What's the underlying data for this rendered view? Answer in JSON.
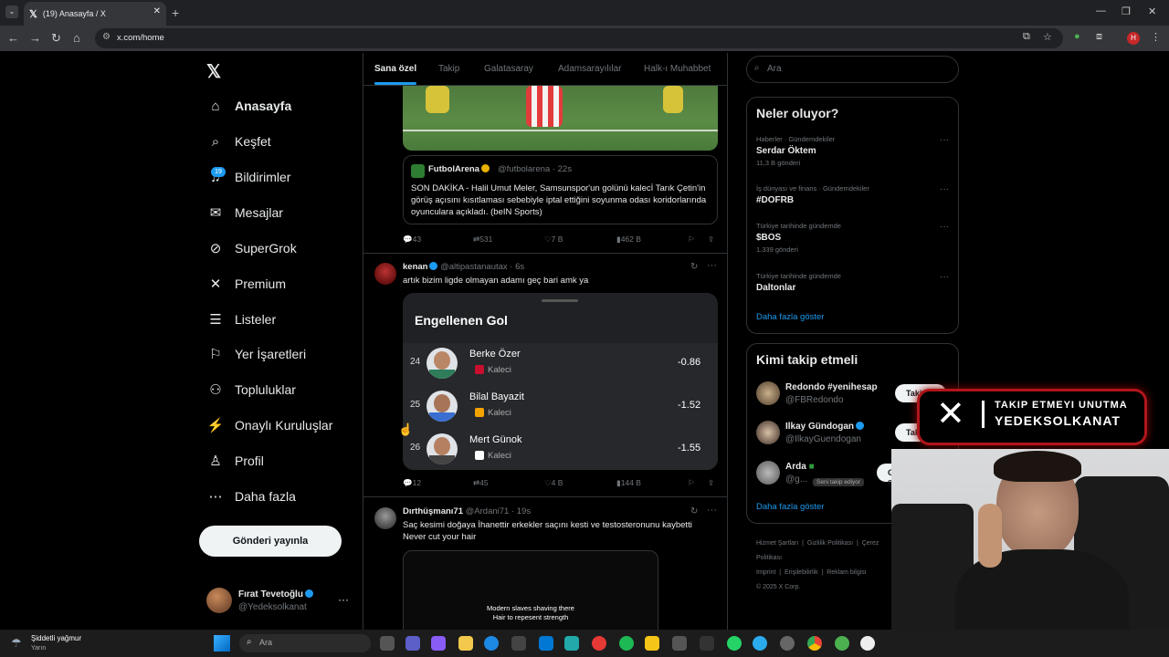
{
  "browser": {
    "tab_title": "(19) Anasayfa / X",
    "tab_close": "✕",
    "new_tab": "+",
    "url": "x.com/home",
    "profile_initial": "H"
  },
  "sidebar": {
    "logo": "𝕏",
    "items": [
      {
        "icon": "home-icon",
        "glyph": "⌂",
        "label": "Anasayfa"
      },
      {
        "icon": "search-icon",
        "glyph": "⌕",
        "label": "Keşfet"
      },
      {
        "icon": "bell-icon",
        "glyph": "♫",
        "label": "Bildirimler"
      },
      {
        "icon": "mail-icon",
        "glyph": "✉",
        "label": "Mesajlar"
      },
      {
        "icon": "grok-icon",
        "glyph": "⊘",
        "label": "SuperGrok"
      },
      {
        "icon": "x-premium-icon",
        "glyph": "✕",
        "label": "Premium"
      },
      {
        "icon": "list-icon",
        "glyph": "☰",
        "label": "Listeler"
      },
      {
        "icon": "bookmark-icon",
        "glyph": "⚐",
        "label": "Yer İşaretleri"
      },
      {
        "icon": "communities-icon",
        "glyph": "⚇",
        "label": "Topluluklar"
      },
      {
        "icon": "lightning-icon",
        "glyph": "⚡",
        "label": "Onaylı Kuruluşlar"
      },
      {
        "icon": "profile-icon",
        "glyph": "♙",
        "label": "Profil"
      },
      {
        "icon": "more-icon",
        "glyph": "⋯",
        "label": "Daha fazla"
      }
    ],
    "notification_count": "19",
    "post_button": "Gönderi yayınla",
    "account": {
      "name": "Fırat Tevetoğlu",
      "handle": "@Yedeksolkanat",
      "menu": "···"
    }
  },
  "feed": {
    "tabs": [
      "Sana özel",
      "Takip",
      "Galatasaray",
      "Adamsarayılılar",
      "Halk-ı Muhabbet"
    ],
    "post1": {
      "quote_name": "FutbolArena",
      "quote_handle": "@futbolarena · 22s",
      "quote_text": "SON DAKİKA - Halil Umut Meler, Samsunspor'un golünü kalecİ Tarık Çetin'in görüş açısını kısıtlaması sebebiyle iptal ettiğini soyunma odası koridorlarında oyunculara açıkladı. (beIN Sports)",
      "replies": "43",
      "reposts": "531",
      "likes": "7 B",
      "views": "462 B"
    },
    "post2": {
      "name": "kenan",
      "handle": "@altipastanautax · 6s",
      "text": "artık bizim ligde olmayan adamı geç bari amk ya",
      "card_title": "Engellenen Gol",
      "players": [
        {
          "rank": "24",
          "name": "Berke Özer",
          "position": "Kaleci",
          "value": "-0.86",
          "club_color": "#c8102e"
        },
        {
          "rank": "25",
          "name": "Bilal Bayazit",
          "position": "Kaleci",
          "value": "-1.52",
          "club_color": "#f4a300"
        },
        {
          "rank": "26",
          "name": "Mert Günok",
          "position": "Kaleci",
          "value": "-1.55",
          "club_color": "#ffffff"
        }
      ],
      "replies": "12",
      "reposts": "45",
      "likes": "4 B",
      "views": "144 B"
    },
    "post3": {
      "name": "Dırthüşmanı71",
      "handle": "@Ardani71 · 19s",
      "text1": "Saç kesimi doğaya İhanettir erkekler saçını kesti ve testosteronunu kaybetti",
      "text2": "Never cut your hair",
      "video_caption1": "Modern slaves shaving there",
      "video_caption2": "Hair to repesent strength"
    }
  },
  "right": {
    "search_placeholder": "Ara",
    "trends_title": "Neler oluyor?",
    "trends": [
      {
        "context": "Haberler · Gündemdekiler",
        "title": "Serdar Öktem",
        "count": "11,3 B gönderi"
      },
      {
        "context": "İş dünyası ve finans · Gündemdekiler",
        "title": "#DOFRB",
        "count": ""
      },
      {
        "context": "Türkiye tarihinde gündemde",
        "title": "$BOS",
        "count": "1.339 gönderi"
      },
      {
        "context": "Türkiye tarihinde gündemde",
        "title": "Daltonlar",
        "count": ""
      }
    ],
    "trends_more": "Daha fazla göster",
    "who_title": "Kimi takip etmeli",
    "who": [
      {
        "name": "Redondo #yenihesap",
        "handle": "@FBRedondo",
        "button": "Takip et"
      },
      {
        "name": "Ilkay Gündogan",
        "handle": "@IlkayGuendogan",
        "button": "Takip et"
      },
      {
        "name": "Arda",
        "handle": "@g...",
        "button": "Geri takip et",
        "follows_you": "Seni takip ediyor"
      }
    ],
    "who_more": "Daha fazla göster",
    "footer": [
      "Hizmet Şartları",
      "Gizlilik Politikası",
      "Çerez Politikası",
      "Imprint",
      "Erişilebilirlik",
      "Reklam bilgisi",
      "© 2025 X Corp."
    ]
  },
  "overlay": {
    "line1": "TAKIP ETMEYI UNUTMA",
    "line2": "YEDEKSOLKANAT"
  },
  "taskbar": {
    "weather": "Şiddetli yağmur",
    "weather_sub": "Yarın",
    "search": "Ara"
  },
  "colors": {
    "accent": "#1d9bf0",
    "background": "#000000",
    "border": "#2f3336",
    "overlay_red": "#b0161a"
  }
}
